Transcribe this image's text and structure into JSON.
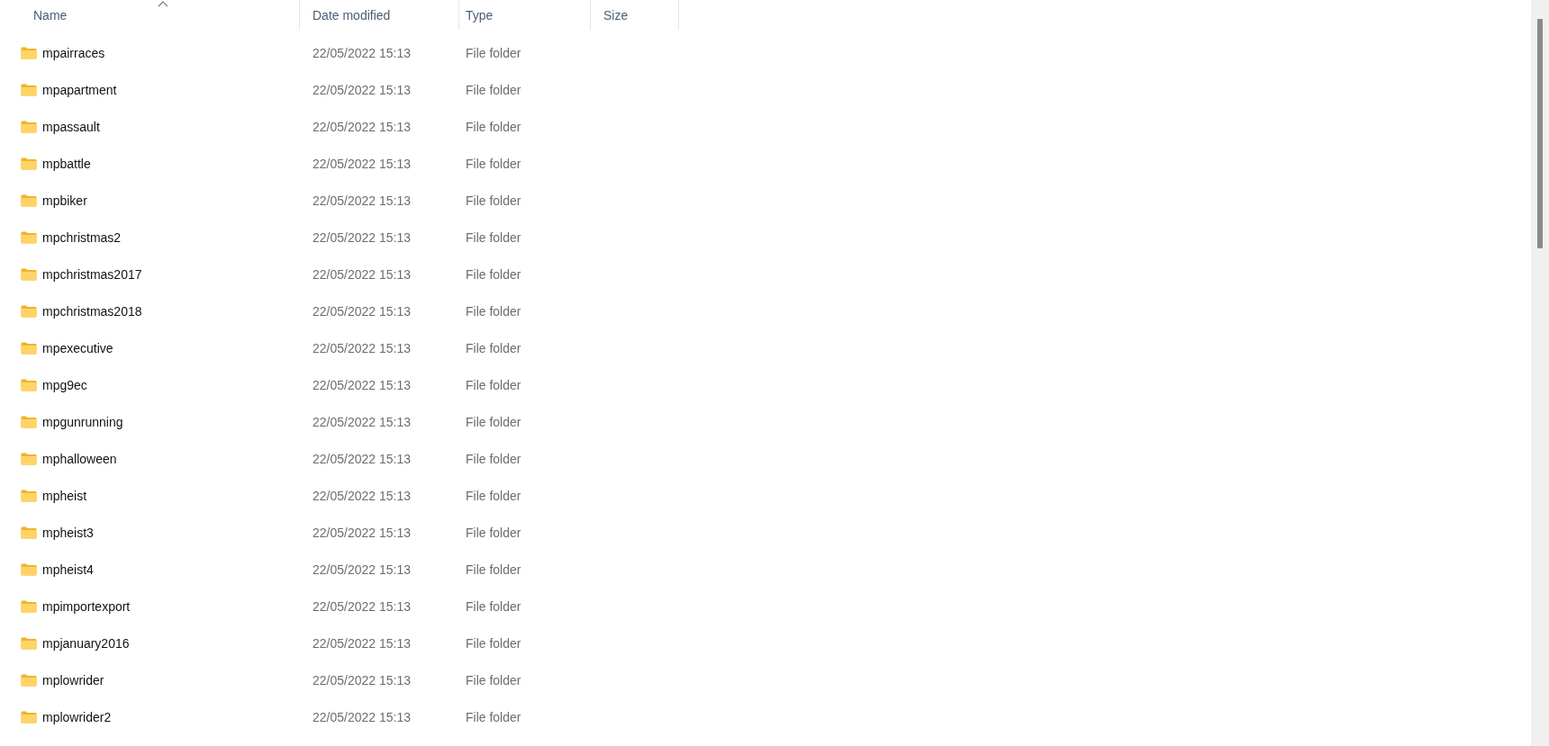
{
  "columns": [
    {
      "label": "Name",
      "sorted": true
    },
    {
      "label": "Date modified",
      "sorted": false
    },
    {
      "label": "Type",
      "sorted": false
    },
    {
      "label": "Size",
      "sorted": false
    }
  ],
  "rows": [
    {
      "name": "mpairraces",
      "date": "22/05/2022 15:13",
      "type": "File folder"
    },
    {
      "name": "mpapartment",
      "date": "22/05/2022 15:13",
      "type": "File folder"
    },
    {
      "name": "mpassault",
      "date": "22/05/2022 15:13",
      "type": "File folder"
    },
    {
      "name": "mpbattle",
      "date": "22/05/2022 15:13",
      "type": "File folder"
    },
    {
      "name": "mpbiker",
      "date": "22/05/2022 15:13",
      "type": "File folder"
    },
    {
      "name": "mpchristmas2",
      "date": "22/05/2022 15:13",
      "type": "File folder"
    },
    {
      "name": "mpchristmas2017",
      "date": "22/05/2022 15:13",
      "type": "File folder"
    },
    {
      "name": "mpchristmas2018",
      "date": "22/05/2022 15:13",
      "type": "File folder"
    },
    {
      "name": "mpexecutive",
      "date": "22/05/2022 15:13",
      "type": "File folder"
    },
    {
      "name": "mpg9ec",
      "date": "22/05/2022 15:13",
      "type": "File folder"
    },
    {
      "name": "mpgunrunning",
      "date": "22/05/2022 15:13",
      "type": "File folder"
    },
    {
      "name": "mphalloween",
      "date": "22/05/2022 15:13",
      "type": "File folder"
    },
    {
      "name": "mpheist",
      "date": "22/05/2022 15:13",
      "type": "File folder"
    },
    {
      "name": "mpheist3",
      "date": "22/05/2022 15:13",
      "type": "File folder"
    },
    {
      "name": "mpheist4",
      "date": "22/05/2022 15:13",
      "type": "File folder"
    },
    {
      "name": "mpimportexport",
      "date": "22/05/2022 15:13",
      "type": "File folder"
    },
    {
      "name": "mpjanuary2016",
      "date": "22/05/2022 15:13",
      "type": "File folder"
    },
    {
      "name": "mplowrider",
      "date": "22/05/2022 15:13",
      "type": "File folder"
    },
    {
      "name": "mplowrider2",
      "date": "22/05/2022 15:13",
      "type": "File folder"
    }
  ]
}
